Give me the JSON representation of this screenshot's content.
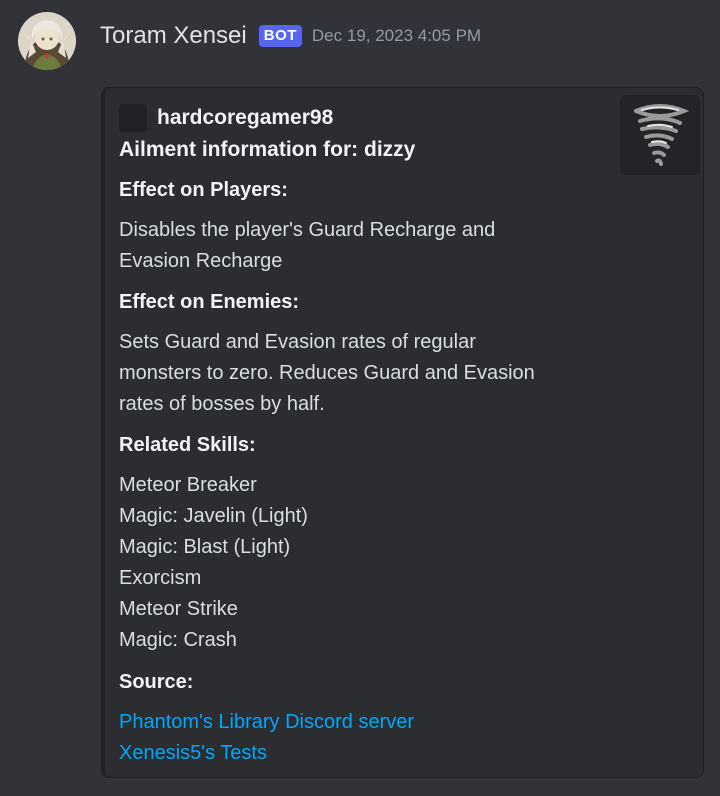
{
  "message": {
    "author": "Toram Xensei",
    "bot_tag": "BOT",
    "timestamp": "Dec 19, 2023 4:05 PM"
  },
  "embed": {
    "author_name": "hardcoregamer98",
    "title": "Ailment information for: dizzy",
    "thumbnail_icon": "tornado-icon",
    "fields": {
      "players": {
        "name": "Effect on Players:",
        "lines": [
          "Disables the player's Guard Recharge and",
          "Evasion Recharge"
        ]
      },
      "enemies": {
        "name": "Effect on Enemies:",
        "lines": [
          "Sets Guard and Evasion rates of regular",
          "monsters to zero. Reduces Guard and Evasion",
          "rates of bosses by half."
        ]
      },
      "skills": {
        "name": "Related Skills:",
        "lines": [
          "Meteor Breaker",
          "Magic: Javelin (Light)",
          "Magic: Blast (Light)",
          "Exorcism",
          "Meteor Strike",
          "Magic: Crash"
        ]
      },
      "source": {
        "name": "Source:",
        "links": [
          "Phantom's Library Discord server",
          "Xenesis5's Tests"
        ]
      }
    }
  },
  "colors": {
    "background": "#313338",
    "embed_background": "#2b2d31",
    "bot_tag": "#5865f2",
    "link": "#00a8fc"
  }
}
